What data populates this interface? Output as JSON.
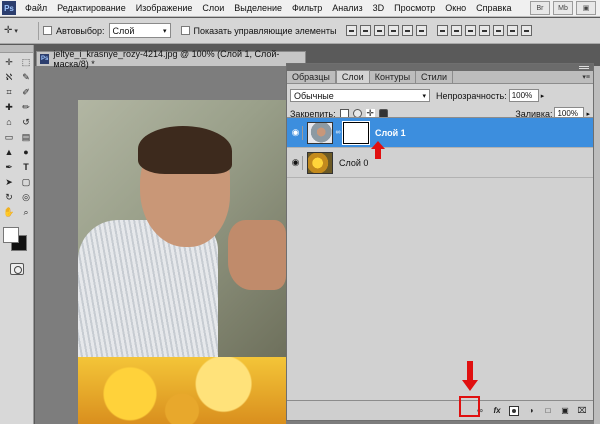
{
  "app": {
    "logo": "Ps",
    "menu": [
      "Файл",
      "Редактирование",
      "Изображение",
      "Слои",
      "Выделение",
      "Фильтр",
      "Анализ",
      "3D",
      "Просмотр",
      "Окно",
      "Справка"
    ],
    "menu_right": [
      "Br",
      "Mb",
      "▣"
    ]
  },
  "options": {
    "autoselect_label": "Автовыбор:",
    "autoselect_value": "Слой",
    "show_controls_label": "Показать управляющие элементы"
  },
  "document": {
    "tab_title": "jeltye_i_krasnye_rozy-4214.jpg @ 100% (Слой 1, Слой-маска/8) *",
    "tab_logo": "Ps"
  },
  "layers_panel": {
    "tabs": [
      "Образцы",
      "Слои",
      "Контуры",
      "Стили"
    ],
    "active_tab": "Слои",
    "blend_mode": "Обычные",
    "opacity_label": "Непрозрачность:",
    "opacity_value": "100%",
    "lock_label": "Закрепить:",
    "fill_label": "Заливка:",
    "fill_value": "100%",
    "layers": [
      {
        "name": "Слой 1",
        "selected": true,
        "has_mask": true
      },
      {
        "name": "Слой 0",
        "selected": false,
        "has_mask": false
      }
    ],
    "bottom_icons": [
      "link-icon",
      "fx-icon",
      "add-mask-icon",
      "adjustment-icon",
      "group-icon",
      "new-layer-icon",
      "trash-icon"
    ]
  },
  "annotations": {
    "arrow_color": "#e01010",
    "highlight_color": "#e01010"
  },
  "colors": {
    "selection": "#3c8ede",
    "foreground": "#ffffff",
    "background": "#111111"
  }
}
